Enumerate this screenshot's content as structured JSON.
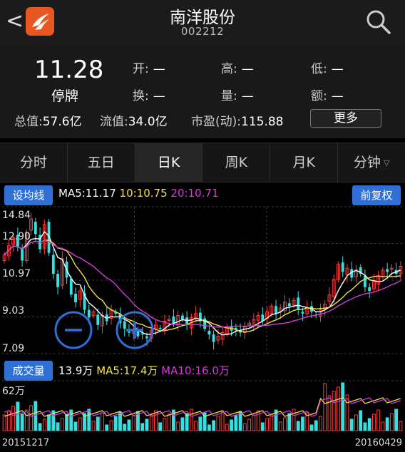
{
  "header": {
    "back": "<",
    "name": "南洋股份",
    "code": "002212"
  },
  "quote": {
    "price": "11.28",
    "status": "停牌",
    "open_label": "开:",
    "open_value": "—",
    "high_label": "高:",
    "high_value": "—",
    "low_label": "低:",
    "low_value": "—",
    "turnover_label": "换:",
    "turnover_value": "—",
    "volume_label": "量:",
    "volume_value": "—",
    "amount_label": "额:",
    "amount_value": "—",
    "total_value_label": "总值:",
    "total_value": "57.6亿",
    "float_value_label": "流值:",
    "float_value": "34.0亿",
    "pe_label": "市盈(动):",
    "pe_value": "115.88",
    "more": "更多"
  },
  "tabs": [
    {
      "label": "分时"
    },
    {
      "label": "五日"
    },
    {
      "label": "日K"
    },
    {
      "label": "周K"
    },
    {
      "label": "月K"
    },
    {
      "label": "分钟"
    }
  ],
  "chart": {
    "ma_settings": "设均线",
    "ma5": "MA5:11.17",
    "ma10": "10:10.75",
    "ma20": "20:10.71",
    "adjust": "前复权",
    "volume_btn": "成交量",
    "vol_value": "13.9万",
    "vol_ma5": "MA5:17.4万",
    "vol_ma10": "MA10:16.0万",
    "y_labels": [
      "14.84",
      "12.90",
      "10.97",
      "9.03",
      "7.09"
    ],
    "vol_label": "62万",
    "start_date": "20151217",
    "end_date": "20160429",
    "colors": {
      "up": "#ff3b3b",
      "down": "#36e0e0",
      "ma5": "#ffffff",
      "ma10": "#f0e24a",
      "ma20": "#d63ad6",
      "button": "#2f6fd6",
      "zoom": "#2f6fd6"
    }
  },
  "chart_data": {
    "type": "candlestick",
    "title": "",
    "xlabel": "",
    "ylabel": "",
    "x_range": [
      "20151217",
      "20160429"
    ],
    "ylim": [
      7.09,
      14.84
    ],
    "y_ticks": [
      14.84,
      12.9,
      10.97,
      9.03,
      7.09
    ],
    "closes": [
      12.3,
      12.8,
      13.2,
      12.7,
      12.0,
      13.5,
      14.2,
      13.4,
      12.6,
      13.9,
      12.4,
      11.3,
      10.6,
      12.1,
      11.1,
      10.2,
      9.8,
      10.4,
      9.4,
      9.0,
      9.3,
      8.6,
      9.1,
      8.8,
      9.4,
      9.2,
      8.7,
      8.4,
      8.2,
      8.3,
      8.0,
      8.1,
      7.9,
      8.3,
      8.6,
      8.4,
      8.8,
      8.9,
      8.7,
      9.1,
      8.9,
      8.6,
      9.0,
      9.2,
      8.8,
      8.4,
      8.1,
      7.7,
      8.0,
      8.2,
      8.5,
      8.3,
      8.4,
      8.2,
      8.5,
      8.7,
      8.9,
      9.1,
      8.8,
      9.3,
      9.6,
      9.2,
      9.5,
      9.8,
      9.6,
      9.9,
      9.4,
      9.2,
      9.5,
      9.3,
      9.1,
      9.4,
      9.7,
      10.2,
      11.0,
      11.8,
      11.4,
      11.6,
      11.1,
      11.5,
      11.3,
      10.6,
      10.4,
      10.9,
      11.2,
      11.5,
      11.4,
      11.6,
      11.3,
      11.7
    ],
    "ma5_last": 11.17,
    "ma10_last": 10.75,
    "ma20_last": 10.71,
    "volume_last": "13.9万",
    "volume_ma5": "17.4万",
    "volume_ma10": "16.0万",
    "volume_scale_max": "62万"
  }
}
